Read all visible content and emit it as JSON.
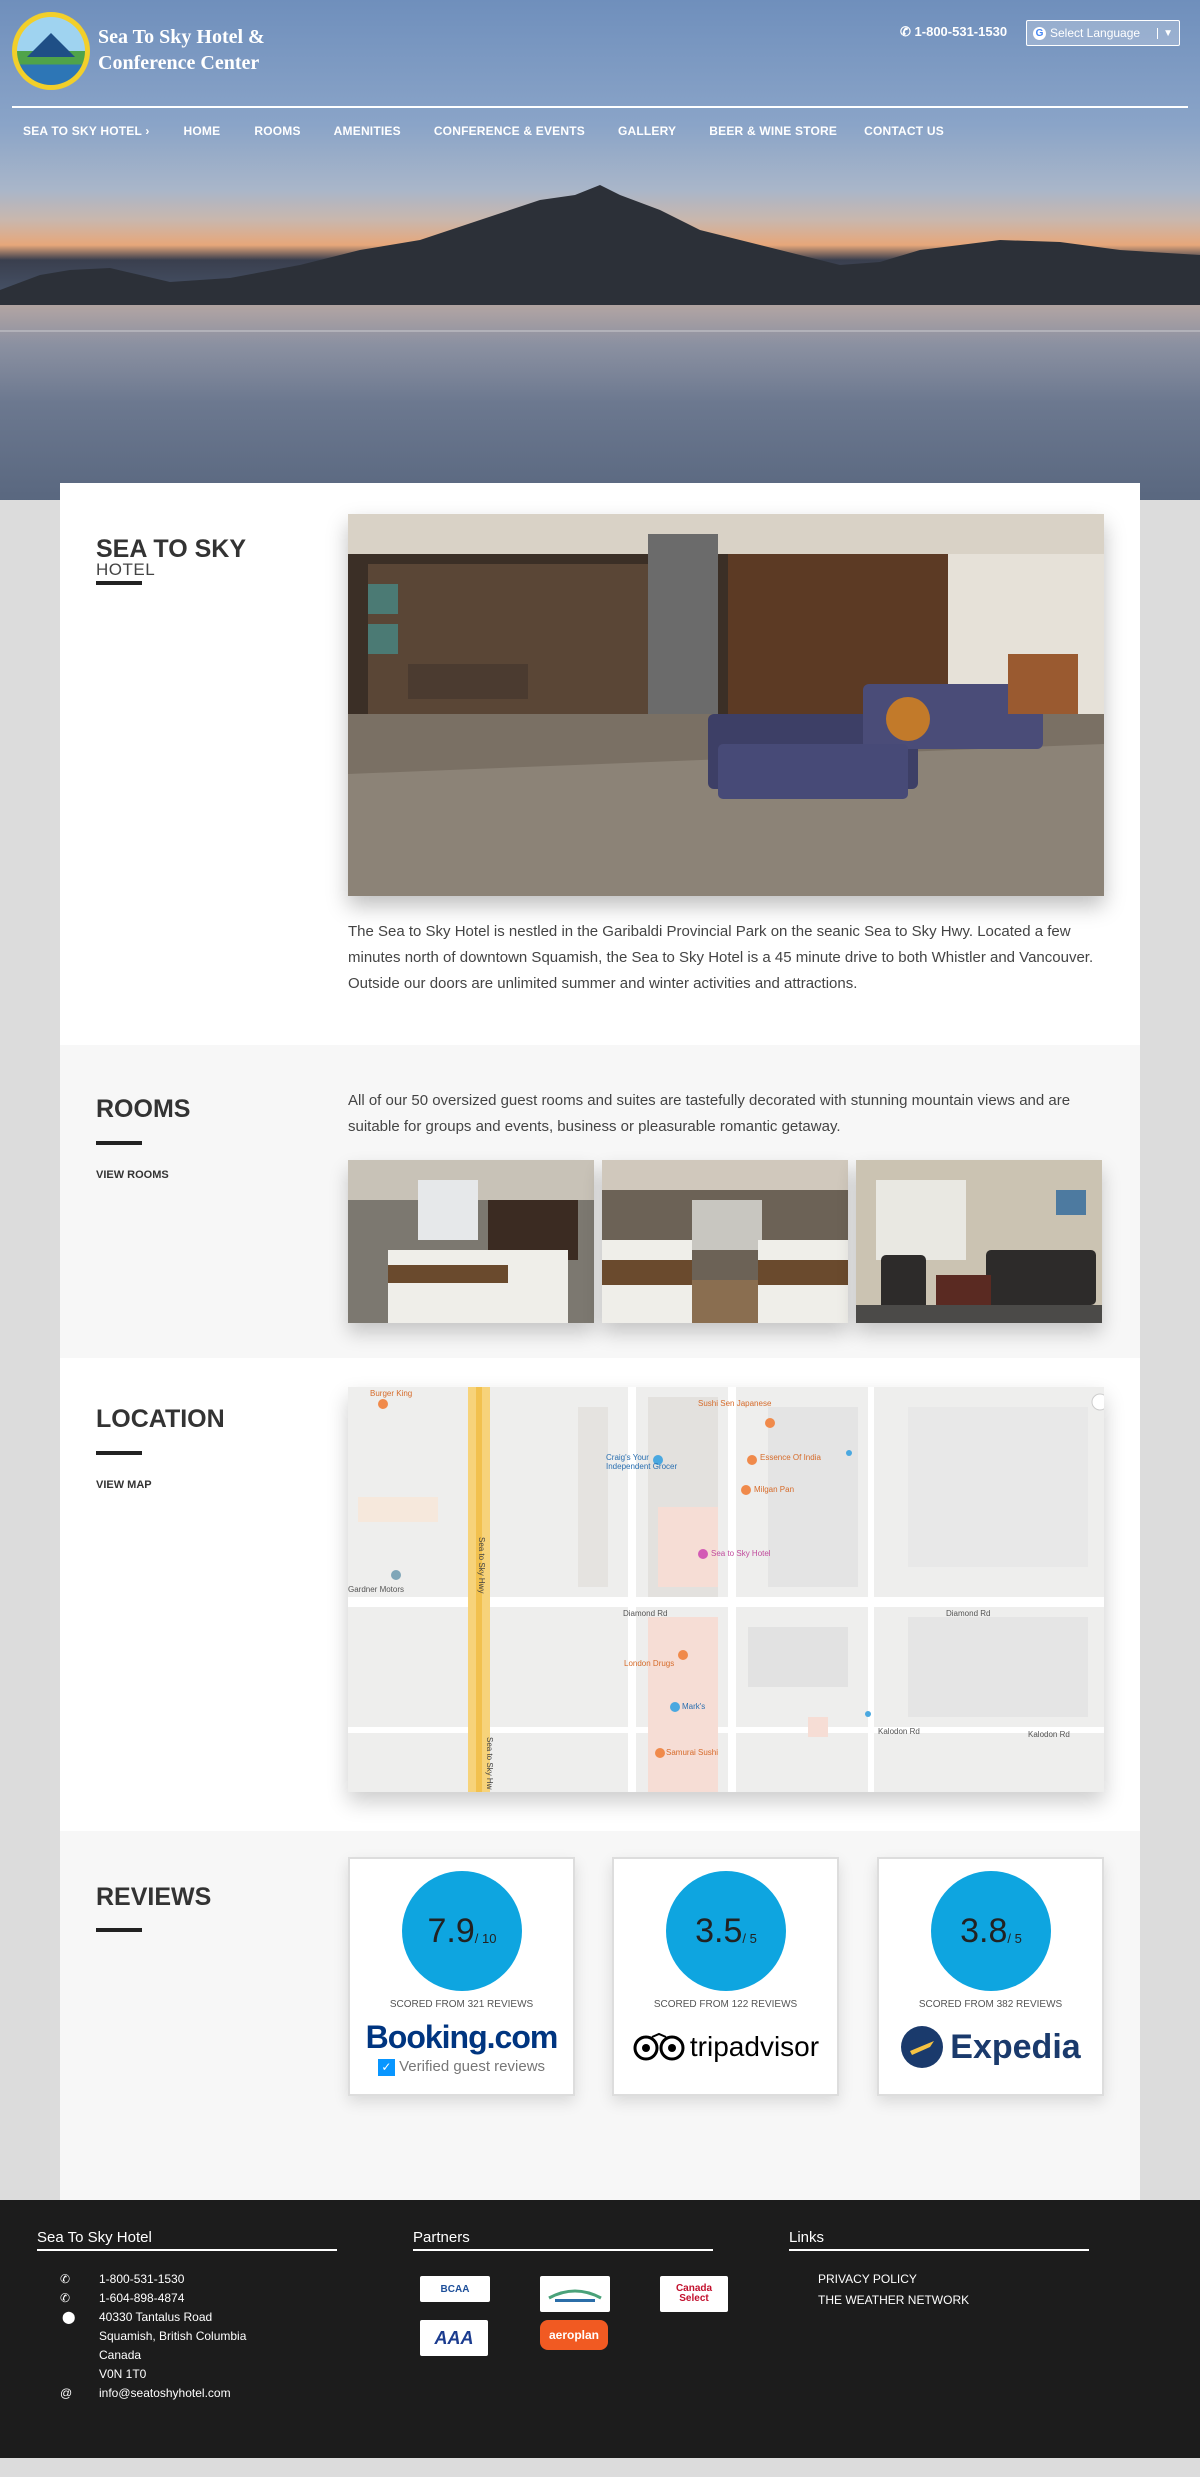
{
  "header": {
    "brand_line1": "Sea To Sky Hotel &",
    "brand_line2": "Conference Center",
    "phone": "1-800-531-1530",
    "language_select": "Select Language"
  },
  "nav": {
    "items": [
      "SEA TO SKY HOTEL ›",
      "HOME",
      "ROOMS",
      "AMENITIES",
      "CONFERENCE & EVENTS",
      "GALLERY",
      "BEER & WINE STORE",
      "CONTACT US"
    ]
  },
  "intro": {
    "title": "SEA TO SKY",
    "subtitle": "HOTEL",
    "text": "The Sea to Sky Hotel is nestled in the Garibaldi Provincial Park on the seanic Sea to Sky Hwy. Located a few minutes north of downtown Squamish, the Sea to Sky Hotel is a 45 minute drive to both Whistler and Vancouver. Outside our doors are unlimited summer and winter activities and attractions."
  },
  "rooms": {
    "title": "ROOMS",
    "link": "VIEW ROOMS",
    "text": "All of our 50 oversized guest rooms and suites are tastefully decorated with stunning mountain views and are suitable for groups and events, business or pleasurable romantic getaway."
  },
  "location": {
    "title": "LOCATION",
    "link": "VIEW MAP",
    "map_labels": {
      "burger_king": "Burger King",
      "sushi": "Sushi Sen Japanese",
      "craigs": "Craig's Your Independent Grocer",
      "essence": "Essence Of India",
      "mr_panis": "Milgan Pan",
      "hotel": "Sea to Sky Hotel",
      "gardner": "Gardner Motors",
      "highway": "Sea to Sky Hwy",
      "highway2": "Sea to Sky Hw",
      "diamond": "Diamond Rd",
      "diamond2": "Diamond Rd",
      "london": "London Drugs",
      "marks": "Mark's",
      "samurai": "Samurai Sushi",
      "kalodon": "Kalodon Rd",
      "kalodon2": "Kalodon Rd"
    }
  },
  "reviews": {
    "title": "REVIEWS",
    "items": [
      {
        "score": "7.9",
        "out_of": "/ 10",
        "scored": "SCORED FROM 321 REVIEWS",
        "brand": "Booking.com",
        "tagline": "Verified guest reviews"
      },
      {
        "score": "3.5",
        "out_of": "/ 5",
        "scored": "SCORED FROM 122 REVIEWS",
        "brand": "tripadvisor"
      },
      {
        "score": "3.8",
        "out_of": "/ 5",
        "scored": "SCORED FROM 382 REVIEWS",
        "brand": "Expedia"
      }
    ]
  },
  "footer": {
    "col1_title": "Sea To Sky Hotel",
    "phone1": "1-800-531-1530",
    "phone2": "1-604-898-4874",
    "addr1": "40330 Tantalus Road",
    "addr2": "Squamish, British Columbia",
    "addr3": "Canada",
    "addr4": "V0N 1T0",
    "email": "info@seatoshyhotel.com",
    "col2_title": "Partners",
    "partners": [
      "BCAA",
      "",
      "Canada Select",
      "AAA",
      "aeroplan"
    ],
    "col3_title": "Links",
    "links": [
      "PRIVACY POLICY",
      "THE WEATHER NETWORK"
    ]
  },
  "colors": {
    "accent": "#0ea5e0",
    "footer_bg": "#1c1c1c",
    "booking_blue": "#003580",
    "expedia_blue": "#1a3a6c"
  }
}
